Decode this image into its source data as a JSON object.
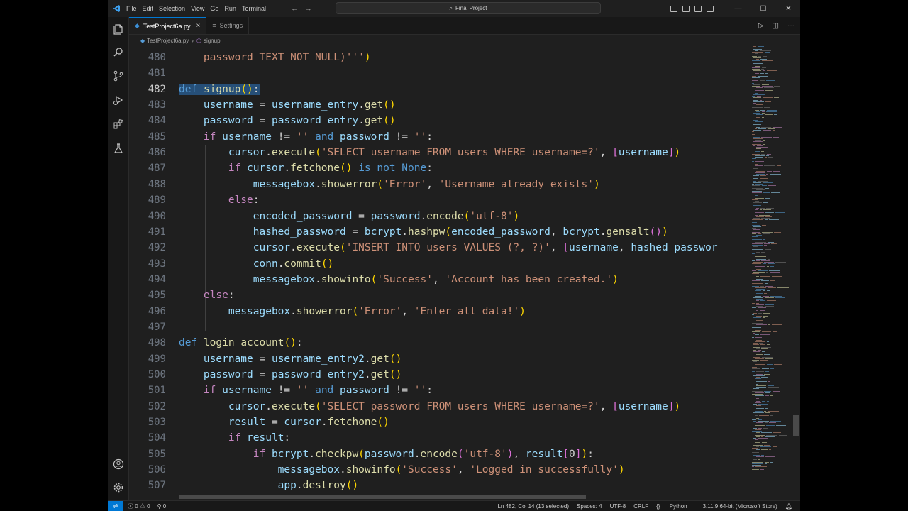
{
  "titlebar": {
    "menu": [
      "File",
      "Edit",
      "Selection",
      "View",
      "Go",
      "Run",
      "Terminal",
      "···"
    ],
    "search_text": "Final Project",
    "window_controls": [
      "—",
      "☐",
      "✕"
    ]
  },
  "tabs": [
    {
      "label": "TestProject6a.py",
      "active": true
    },
    {
      "label": "Settings",
      "active": false
    }
  ],
  "breadcrumb": {
    "file": "TestProject6a.py",
    "symbol": "signup"
  },
  "editor": {
    "current_line": 482,
    "lines": [
      {
        "n": "480"
      },
      {
        "n": "481"
      },
      {
        "n": "482"
      },
      {
        "n": "483"
      },
      {
        "n": "484"
      },
      {
        "n": "485"
      },
      {
        "n": "486"
      },
      {
        "n": "487"
      },
      {
        "n": "488"
      },
      {
        "n": "489"
      },
      {
        "n": "490"
      },
      {
        "n": "491"
      },
      {
        "n": "492"
      },
      {
        "n": "493"
      },
      {
        "n": "494"
      },
      {
        "n": "495"
      },
      {
        "n": "496"
      },
      {
        "n": "497"
      },
      {
        "n": "498"
      },
      {
        "n": "499"
      },
      {
        "n": "500"
      },
      {
        "n": "501"
      },
      {
        "n": "502"
      },
      {
        "n": "503"
      },
      {
        "n": "504"
      },
      {
        "n": "505"
      },
      {
        "n": "506"
      },
      {
        "n": "507"
      }
    ],
    "code": [
      [
        [
          "str",
          "    password TEXT NOT NULL)'''"
        ],
        [
          "pn",
          ")"
        ]
      ],
      [],
      [
        [
          "kw sel",
          "def"
        ],
        [
          "sel",
          " "
        ],
        [
          "fn sel",
          "signup"
        ],
        [
          "pn sel",
          "()"
        ],
        [
          "op sel",
          ":"
        ]
      ],
      [
        [
          "var",
          "    username"
        ],
        [
          "op",
          " = "
        ],
        [
          "var",
          "username_entry"
        ],
        [
          "op",
          "."
        ],
        [
          "fn",
          "get"
        ],
        [
          "pn",
          "()"
        ]
      ],
      [
        [
          "var",
          "    password"
        ],
        [
          "op",
          " = "
        ],
        [
          "var",
          "password_entry"
        ],
        [
          "op",
          "."
        ],
        [
          "fn",
          "get"
        ],
        [
          "pn",
          "()"
        ]
      ],
      [
        [
          "ctl",
          "    if"
        ],
        [
          "var",
          " username"
        ],
        [
          "op",
          " != "
        ],
        [
          "str",
          "''"
        ],
        [
          "kw",
          " and"
        ],
        [
          "var",
          " password"
        ],
        [
          "op",
          " != "
        ],
        [
          "str",
          "''"
        ],
        [
          "op",
          ":"
        ]
      ],
      [
        [
          "var",
          "        cursor"
        ],
        [
          "op",
          "."
        ],
        [
          "fn",
          "execute"
        ],
        [
          "pn",
          "("
        ],
        [
          "str",
          "'SELECT username FROM users WHERE username=?'"
        ],
        [
          "op",
          ", "
        ],
        [
          "pn2",
          "["
        ],
        [
          "var",
          "username"
        ],
        [
          "pn2",
          "]"
        ],
        [
          "pn",
          ")"
        ]
      ],
      [
        [
          "ctl",
          "        if"
        ],
        [
          "var",
          " cursor"
        ],
        [
          "op",
          "."
        ],
        [
          "fn",
          "fetchone"
        ],
        [
          "pn",
          "()"
        ],
        [
          "kw",
          " is not"
        ],
        [
          "kw",
          " None"
        ],
        [
          "op",
          ":"
        ]
      ],
      [
        [
          "var",
          "            messagebox"
        ],
        [
          "op",
          "."
        ],
        [
          "fn",
          "showerror"
        ],
        [
          "pn",
          "("
        ],
        [
          "str",
          "'Error'"
        ],
        [
          "op",
          ", "
        ],
        [
          "str",
          "'Username already exists'"
        ],
        [
          "pn",
          ")"
        ]
      ],
      [
        [
          "ctl",
          "        else"
        ],
        [
          "op",
          ":"
        ]
      ],
      [
        [
          "var",
          "            encoded_password"
        ],
        [
          "op",
          " = "
        ],
        [
          "var",
          "password"
        ],
        [
          "op",
          "."
        ],
        [
          "fn",
          "encode"
        ],
        [
          "pn",
          "("
        ],
        [
          "str",
          "'utf-8'"
        ],
        [
          "pn",
          ")"
        ]
      ],
      [
        [
          "var",
          "            hashed_password"
        ],
        [
          "op",
          " = "
        ],
        [
          "var",
          "bcrypt"
        ],
        [
          "op",
          "."
        ],
        [
          "fn",
          "hashpw"
        ],
        [
          "pn",
          "("
        ],
        [
          "var",
          "encoded_password"
        ],
        [
          "op",
          ", "
        ],
        [
          "var",
          "bcrypt"
        ],
        [
          "op",
          "."
        ],
        [
          "fn",
          "gensalt"
        ],
        [
          "pn2",
          "()"
        ],
        [
          "pn",
          ")"
        ]
      ],
      [
        [
          "var",
          "            cursor"
        ],
        [
          "op",
          "."
        ],
        [
          "fn",
          "execute"
        ],
        [
          "pn",
          "("
        ],
        [
          "str",
          "'INSERT INTO users VALUES (?, ?)'"
        ],
        [
          "op",
          ", "
        ],
        [
          "pn2",
          "["
        ],
        [
          "var",
          "username"
        ],
        [
          "op",
          ", "
        ],
        [
          "var",
          "hashed_passwor"
        ]
      ],
      [
        [
          "var",
          "            conn"
        ],
        [
          "op",
          "."
        ],
        [
          "fn",
          "commit"
        ],
        [
          "pn",
          "()"
        ]
      ],
      [
        [
          "var",
          "            messagebox"
        ],
        [
          "op",
          "."
        ],
        [
          "fn",
          "showinfo"
        ],
        [
          "pn",
          "("
        ],
        [
          "str",
          "'Success'"
        ],
        [
          "op",
          ", "
        ],
        [
          "str",
          "'Account has been created.'"
        ],
        [
          "pn",
          ")"
        ]
      ],
      [
        [
          "ctl",
          "    else"
        ],
        [
          "op",
          ":"
        ]
      ],
      [
        [
          "var",
          "        messagebox"
        ],
        [
          "op",
          "."
        ],
        [
          "fn",
          "showerror"
        ],
        [
          "pn",
          "("
        ],
        [
          "str",
          "'Error'"
        ],
        [
          "op",
          ", "
        ],
        [
          "str",
          "'Enter all data!'"
        ],
        [
          "pn",
          ")"
        ]
      ],
      [],
      [
        [
          "kw",
          "def"
        ],
        [
          "op",
          " "
        ],
        [
          "fn",
          "login_account"
        ],
        [
          "pn",
          "()"
        ],
        [
          "op",
          ":"
        ]
      ],
      [
        [
          "var",
          "    username"
        ],
        [
          "op",
          " = "
        ],
        [
          "var",
          "username_entry2"
        ],
        [
          "op",
          "."
        ],
        [
          "fn",
          "get"
        ],
        [
          "pn",
          "()"
        ]
      ],
      [
        [
          "var",
          "    password"
        ],
        [
          "op",
          " = "
        ],
        [
          "var",
          "password_entry2"
        ],
        [
          "op",
          "."
        ],
        [
          "fn",
          "get"
        ],
        [
          "pn",
          "()"
        ]
      ],
      [
        [
          "ctl",
          "    if"
        ],
        [
          "var",
          " username"
        ],
        [
          "op",
          " != "
        ],
        [
          "str",
          "''"
        ],
        [
          "kw",
          " and"
        ],
        [
          "var",
          " password"
        ],
        [
          "op",
          " != "
        ],
        [
          "str",
          "''"
        ],
        [
          "op",
          ":"
        ]
      ],
      [
        [
          "var",
          "        cursor"
        ],
        [
          "op",
          "."
        ],
        [
          "fn",
          "execute"
        ],
        [
          "pn",
          "("
        ],
        [
          "str",
          "'SELECT password FROM users WHERE username=?'"
        ],
        [
          "op",
          ", "
        ],
        [
          "pn2",
          "["
        ],
        [
          "var",
          "username"
        ],
        [
          "pn2",
          "]"
        ],
        [
          "pn",
          ")"
        ]
      ],
      [
        [
          "var",
          "        result"
        ],
        [
          "op",
          " = "
        ],
        [
          "var",
          "cursor"
        ],
        [
          "op",
          "."
        ],
        [
          "fn",
          "fetchone"
        ],
        [
          "pn",
          "()"
        ]
      ],
      [
        [
          "ctl",
          "        if"
        ],
        [
          "var",
          " result"
        ],
        [
          "op",
          ":"
        ]
      ],
      [
        [
          "ctl",
          "            if"
        ],
        [
          "var",
          " bcrypt"
        ],
        [
          "op",
          "."
        ],
        [
          "fn",
          "checkpw"
        ],
        [
          "pn",
          "("
        ],
        [
          "var",
          "password"
        ],
        [
          "op",
          "."
        ],
        [
          "fn",
          "encode"
        ],
        [
          "pn2",
          "("
        ],
        [
          "str",
          "'utf-8'"
        ],
        [
          "pn2",
          ")"
        ],
        [
          "op",
          ", "
        ],
        [
          "var",
          "result"
        ],
        [
          "pn2",
          "["
        ],
        [
          "op",
          "0"
        ],
        [
          "pn2",
          "]"
        ],
        [
          "pn",
          ")"
        ],
        [
          "op",
          ":"
        ]
      ],
      [
        [
          "var",
          "                messagebox"
        ],
        [
          "op",
          "."
        ],
        [
          "fn",
          "showinfo"
        ],
        [
          "pn",
          "("
        ],
        [
          "str",
          "'Success'"
        ],
        [
          "op",
          ", "
        ],
        [
          "str",
          "'Logged in successfully'"
        ],
        [
          "pn",
          ")"
        ]
      ],
      [
        [
          "var",
          "                app"
        ],
        [
          "op",
          "."
        ],
        [
          "fn",
          "destroy"
        ],
        [
          "pn",
          "()"
        ]
      ]
    ]
  },
  "statusbar": {
    "errors": "0",
    "warnings": "0",
    "ports": "0",
    "position": "Ln 482, Col 14 (13 selected)",
    "spaces": "Spaces: 4",
    "encoding": "UTF-8",
    "eol": "CRLF",
    "language": "Python",
    "interpreter": "3.11.9 64-bit (Microsoft Store)"
  },
  "colors": {
    "accent": "#0078d4",
    "editor_bg": "#1f1f1f",
    "keyword": "#569cd6",
    "control": "#c586c0",
    "function": "#dcdcaa",
    "variable": "#9cdcfe",
    "string": "#ce9178"
  }
}
